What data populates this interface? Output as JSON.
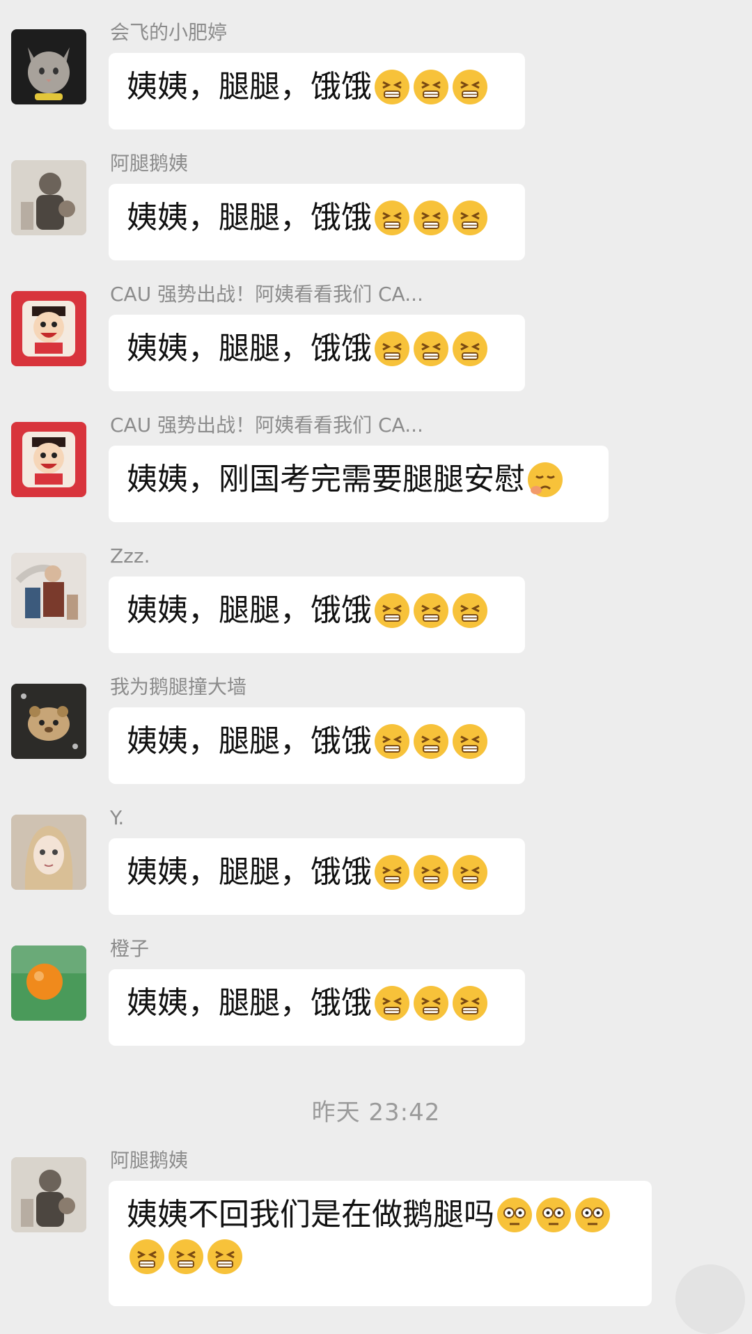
{
  "messages": [
    {
      "sender": "会飞的小肥婷",
      "text": "姨姨，腿腿，饿饿",
      "emojis": [
        "grimace-emoji",
        "grimace-emoji",
        "grimace-emoji"
      ],
      "avatar": "cat-avatar-icon"
    },
    {
      "sender": "阿腿鹅姨",
      "text": "姨姨，腿腿，饿饿",
      "emojis": [
        "grimace-emoji",
        "grimace-emoji",
        "grimace-emoji"
      ],
      "avatar": "person-photo-avatar-icon"
    },
    {
      "sender": "CAU 强势出战！阿姨看看我们 CA...",
      "text": "姨姨，腿腿，饿饿",
      "emojis": [
        "grimace-emoji",
        "grimace-emoji",
        "grimace-emoji"
      ],
      "avatar": "cartoon-kid-avatar-icon"
    },
    {
      "sender": "CAU 强势出战！阿姨看看我们 CA...",
      "text": "姨姨，刚国考完需要腿腿安慰",
      "emojis": [
        "sad-emoji"
      ],
      "avatar": "cartoon-kid-avatar-icon"
    },
    {
      "sender": "Zzz.",
      "text": "姨姨，腿腿，饿饿",
      "emojis": [
        "grimace-emoji",
        "grimace-emoji",
        "grimace-emoji"
      ],
      "avatar": "illustration-avatar-icon"
    },
    {
      "sender": "我为鹅腿撞大墙",
      "text": "姨姨，腿腿，饿饿",
      "emojis": [
        "grimace-emoji",
        "grimace-emoji",
        "grimace-emoji"
      ],
      "avatar": "hamster-avatar-icon"
    },
    {
      "sender": "Y.",
      "text": "姨姨，腿腿，饿饿",
      "emojis": [
        "grimace-emoji",
        "grimace-emoji",
        "grimace-emoji"
      ],
      "avatar": "anime-girl-avatar-icon"
    },
    {
      "sender": "橙子",
      "text": "姨姨，腿腿，饿饿",
      "emojis": [
        "grimace-emoji",
        "grimace-emoji",
        "grimace-emoji"
      ],
      "avatar": "orange-avatar-icon"
    },
    {
      "sender": "阿腿鹅姨",
      "text": "姨姨不回我们是在做鹅腿吗",
      "emojis": [
        "wide-eyes-emoji",
        "wide-eyes-emoji",
        "wide-eyes-emoji"
      ],
      "emojis_line2": [
        "grimace-emoji",
        "grimace-emoji",
        "grimace-emoji"
      ],
      "avatar": "person-photo-avatar-icon"
    }
  ],
  "timestamp": "昨天 23:42",
  "colors": {
    "background": "#ededed",
    "bubble": "#ffffff",
    "sender": "#8c8c8c",
    "emoji": "#f7c23a"
  }
}
